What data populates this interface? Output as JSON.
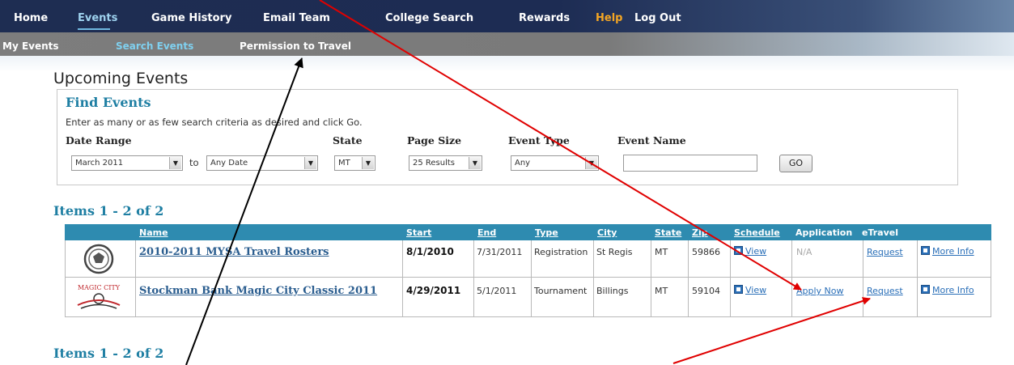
{
  "topnav": {
    "items": [
      "Home",
      "Events",
      "Game History",
      "Email Team",
      "College Search",
      "Rewards",
      "Help",
      "Log Out"
    ]
  },
  "subnav": {
    "items": [
      "My Events",
      "Search Events",
      "Permission to Travel"
    ]
  },
  "page_title": "Upcoming Events",
  "find": {
    "title": "Find Events",
    "help_text": "Enter as many or as few search criteria as desired and click Go.",
    "labels": {
      "date_range": "Date Range",
      "state": "State",
      "page_size": "Page Size",
      "event_type": "Event Type",
      "event_name": "Event Name",
      "to": "to"
    },
    "date_from": "March 2011",
    "date_to": "Any Date",
    "state": "MT",
    "page_size": "25 Results",
    "event_type": "Any",
    "event_name": "",
    "go_label": "GO"
  },
  "items_heading": "Items 1 - 2 of 2",
  "table": {
    "headers": {
      "name": "Name",
      "start": "Start",
      "end": "End",
      "type": "Type",
      "city": "City",
      "state": "State",
      "zip": "Zip",
      "schedule": "Schedule",
      "application": "Application",
      "etravel": "eTravel"
    },
    "rows": [
      {
        "name": "2010-2011 MYSA Travel Rosters",
        "start": "8/1/2010",
        "end": "7/31/2011",
        "type": "Registration",
        "city": "St Regis",
        "state": "MT",
        "zip": "59866",
        "schedule": "View",
        "application": "N/A",
        "etravel": "Request",
        "more": "More Info"
      },
      {
        "name": "Stockman Bank Magic City Classic 2011",
        "start": "4/29/2011",
        "end": "5/1/2011",
        "type": "Tournament",
        "city": "Billings",
        "state": "MT",
        "zip": "59104",
        "schedule": "View",
        "application": "Apply Now",
        "etravel": "Request",
        "more": "More Info",
        "logo_text": "MAGIC CITY"
      }
    ]
  },
  "colors": {
    "topnav": "#1e2d52",
    "subnav": "#7d7d7d",
    "heading_blue": "#1f7fa3",
    "table_header": "#2e8bb0",
    "annotation_red": "#e00000"
  }
}
